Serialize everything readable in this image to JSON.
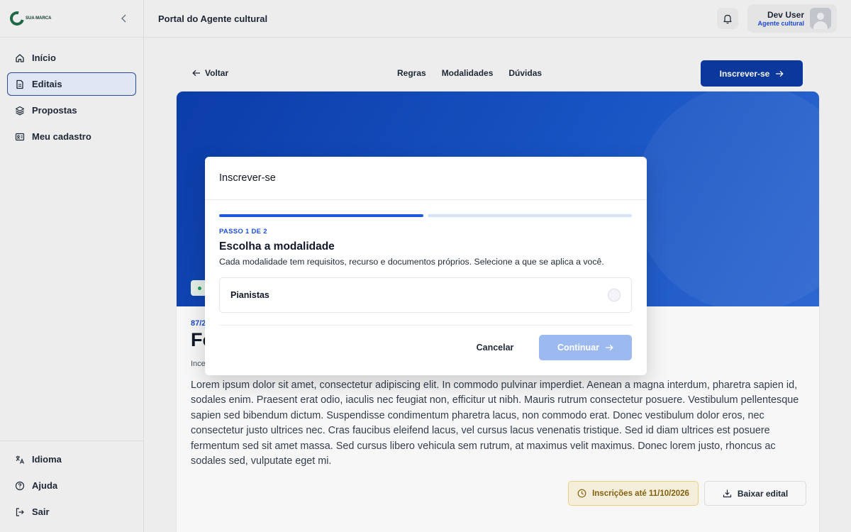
{
  "brand": {
    "logo_text": "SUA MARCA",
    "logo_subtext": ""
  },
  "sidebar": {
    "items": [
      {
        "label": "Início",
        "icon": "home-icon"
      },
      {
        "label": "Editais",
        "icon": "document-icon",
        "active": true
      },
      {
        "label": "Propostas",
        "icon": "layers-icon"
      },
      {
        "label": "Meu cadastro",
        "icon": "id-card-icon"
      }
    ],
    "bottom_items": [
      {
        "label": "Idioma",
        "icon": "translate-icon"
      },
      {
        "label": "Ajuda",
        "icon": "help-circle-icon"
      },
      {
        "label": "Sair",
        "icon": "logout-icon"
      }
    ]
  },
  "topbar": {
    "title": "Portal do Agente cultural",
    "user_name": "Dev User",
    "user_role": "Agente cultural"
  },
  "subnav": {
    "back_label": "Voltar",
    "tabs": [
      "Regras",
      "Modalidades",
      "Dúvidas"
    ],
    "subscribe_label": "Inscrever-se"
  },
  "card": {
    "code": "87/2",
    "title": "Fo",
    "meta": "Ince",
    "description": "Lorem ipsum dolor sit amet, consectetur adipiscing elit. In commodo pulvinar imperdiet. Aenean a magna interdum, pharetra sapien id, sodales enim. Praesent erat odio, iaculis nec feugiat non, efficitur ut nibh. Mauris rutrum consectetur posuere. Vestibulum pellentesque sapien sed bibendum dictum. Suspendisse condimentum pharetra lacus, non commodo erat. Donec vestibulum dolor eros, nec consectetur justo ultrices nec. Cras faucibus eleifend lacus, vel cursus lacus venenatis tristique. Sed id diam ultrices est posuere fermentum sed sit amet massa. Sed cursus libero vehicula sem rutrum, at maximus velit maximus. Donec lorem justo, rhoncus ac sodales sed, vulputate eget mi.",
    "deadline_label": "Inscrições até 11/10/2026",
    "download_label": "Baixar edital"
  },
  "modal": {
    "title": "Inscrever-se",
    "step_label": "PASSO 1 DE 2",
    "step_current": 1,
    "step_total": 2,
    "step_title": "Escolha a modalidade",
    "step_description": "Cada modalidade tem requisitos, recurso e documentos próprios. Selecione a que se aplica a você.",
    "options": [
      {
        "label": "Pianistas",
        "selected": false
      }
    ],
    "cancel_label": "Cancelar",
    "continue_label": "Continuar",
    "continue_enabled": false
  },
  "colors": {
    "primary": "#0c3a9f",
    "accent_blue": "#1d4ed8",
    "continue_disabled": "#9cb9f0",
    "deadline_bg": "#fdf6e3",
    "active_nav_bg": "#e8eefb"
  }
}
